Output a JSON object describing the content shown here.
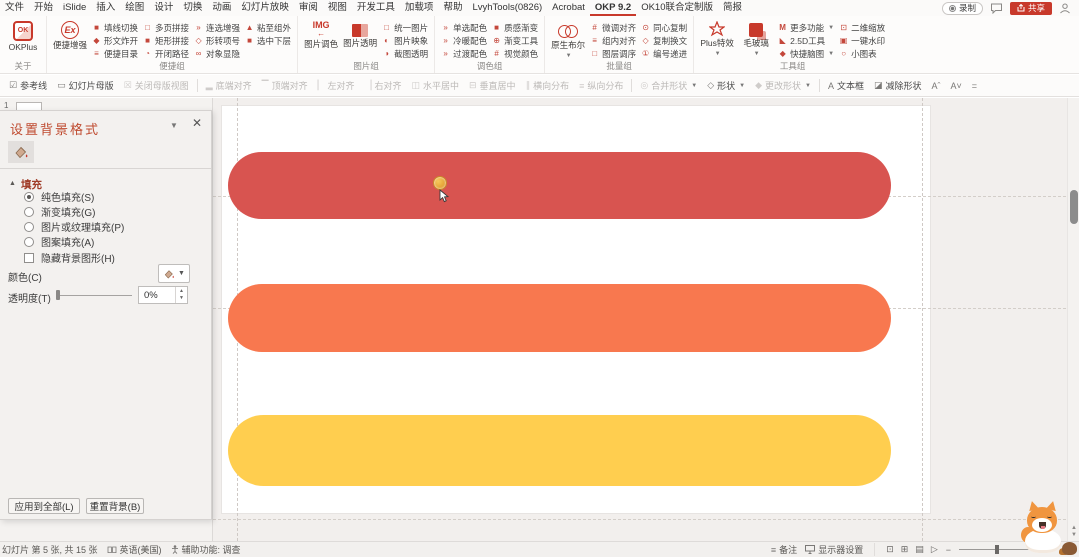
{
  "menu": {
    "items": [
      "文件",
      "开始",
      "iSlide",
      "插入",
      "绘图",
      "设计",
      "切换",
      "动画",
      "幻灯片放映",
      "审阅",
      "视图",
      "开发工具",
      "加载项",
      "帮助",
      "LvyhTools(0826)",
      "Acrobat",
      "OKP 9.2",
      "OK10联合定制版",
      "简报"
    ],
    "active_tab": "OKP 9.2",
    "record": "录制",
    "share": "共享"
  },
  "ribbon": {
    "about": {
      "button": "OKPlus",
      "group": "关于"
    },
    "convenient": {
      "big": "便捷增强",
      "items": [
        "填线切换",
        "形文炸开",
        "便捷目录",
        "多页拼接",
        "矩形拼接",
        "开闭路径",
        "连选增强",
        "形转项号",
        "对象显隐",
        "粘至组外",
        "选中下层"
      ],
      "group": "便捷组"
    },
    "picture": {
      "big1": "图片调色",
      "big2": "图片透明",
      "items": [
        "统一图片",
        "图片映象",
        "截图透明"
      ],
      "group": "图片组"
    },
    "palette": {
      "items": [
        "单选配色",
        "冷暖配色",
        "过渡配色",
        "质感渐变",
        "渐变工具",
        "视觉颜色"
      ],
      "group": "调色组"
    },
    "batch": {
      "big": "原生布尔",
      "items": [
        "微调对齐",
        "组内对齐",
        "图层调序",
        "同心复制",
        "复制换文",
        "编号递进"
      ],
      "group": "批量组"
    },
    "tools": {
      "big1": "Plus特效",
      "big2": "毛玻璃",
      "items": [
        "更多功能",
        "2.5D工具",
        "快捷脑图",
        "二维缩放",
        "一键水印",
        "小图表"
      ],
      "group": "工具组"
    }
  },
  "toolbar": {
    "guides": "参考线",
    "master": "幻灯片母版",
    "close_master": "关闭母版视图",
    "align": [
      "底端对齐",
      "顶端对齐",
      "左对齐",
      "右对齐",
      "水平居中",
      "垂直居中",
      "横向分布",
      "纵向分布"
    ],
    "merge_shapes": "合并形状",
    "shapes": "形状",
    "change_shape": "更改形状",
    "textbox": "文本框",
    "subtract_shape": "减除形状"
  },
  "slides_pane": {
    "slide_number": "1"
  },
  "panel": {
    "title": "设置背景格式",
    "fill_section": "填充",
    "radio_solid": "纯色填充(S)",
    "radio_gradient": "渐变填充(G)",
    "radio_picture": "图片或纹理填充(P)",
    "radio_pattern": "图案填充(A)",
    "checkbox_hide": "隐藏背景图形(H)",
    "color_label": "颜色(C)",
    "transparency_label": "透明度(T)",
    "transparency_value": "0%",
    "apply_all_button": "应用到全部(L)",
    "reset_button": "重置背景(B)"
  },
  "canvas": {
    "shapes": [
      {
        "name": "top-banner",
        "color": "#D85450"
      },
      {
        "name": "middle-banner",
        "color": "#F8784F"
      },
      {
        "name": "bottom-banner",
        "color": "#FFCE4F"
      }
    ]
  },
  "statusbar": {
    "slide_info": "幻灯片 第 5 张, 共 15 张",
    "language": "英语(美国)",
    "accessibility": "辅助功能: 调查",
    "notes": "备注",
    "display_settings": "显示器设置"
  },
  "colors": {
    "accent": "#C8392B"
  }
}
